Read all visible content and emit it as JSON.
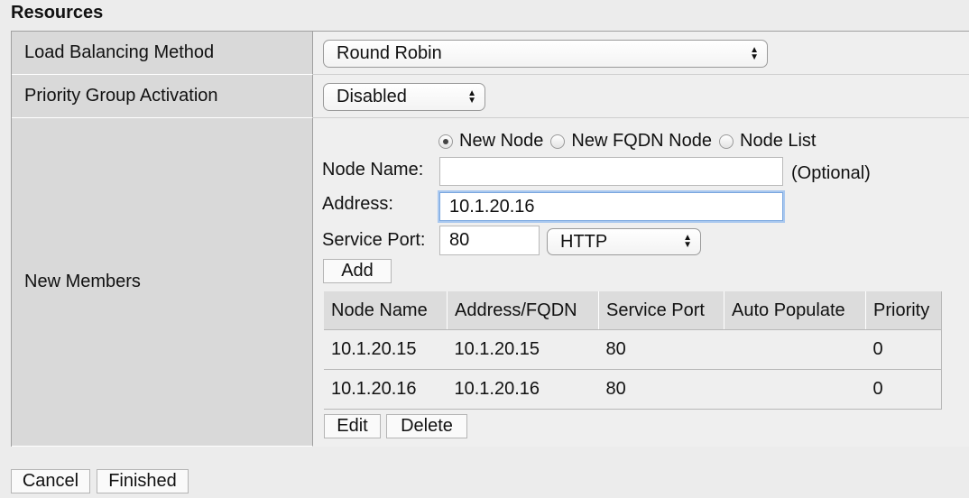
{
  "section": {
    "title": "Resources"
  },
  "rows": {
    "load_balancing": {
      "label": "Load Balancing Method",
      "value": "Round Robin"
    },
    "priority_group": {
      "label": "Priority Group Activation",
      "value": "Disabled"
    },
    "new_members": {
      "label": "New Members"
    }
  },
  "new_member_form": {
    "node_type_options": [
      "New Node",
      "New FQDN Node",
      "Node List"
    ],
    "selected_node_type": "New Node",
    "node_name_label": "Node Name:",
    "node_name_value": "",
    "optional_hint": "(Optional)",
    "address_label": "Address:",
    "address_value": "10.1.20.16",
    "service_port_label": "Service Port:",
    "service_port_value": "80",
    "service_select": "HTTP",
    "add_button": "Add"
  },
  "members_table": {
    "columns": [
      "Node Name",
      "Address/FQDN",
      "Service Port",
      "Auto Populate",
      "Priority"
    ],
    "rows": [
      [
        "10.1.20.15",
        "10.1.20.15",
        "80",
        "",
        "0"
      ],
      [
        "10.1.20.16",
        "10.1.20.16",
        "80",
        "",
        "0"
      ]
    ]
  },
  "table_actions": {
    "edit": "Edit",
    "delete": "Delete"
  },
  "footer": {
    "cancel": "Cancel",
    "finished": "Finished"
  },
  "icons": {
    "select_arrows": "updown-arrows-icon",
    "radio_selected": "radio-selected-icon",
    "radio": "radio-icon"
  }
}
